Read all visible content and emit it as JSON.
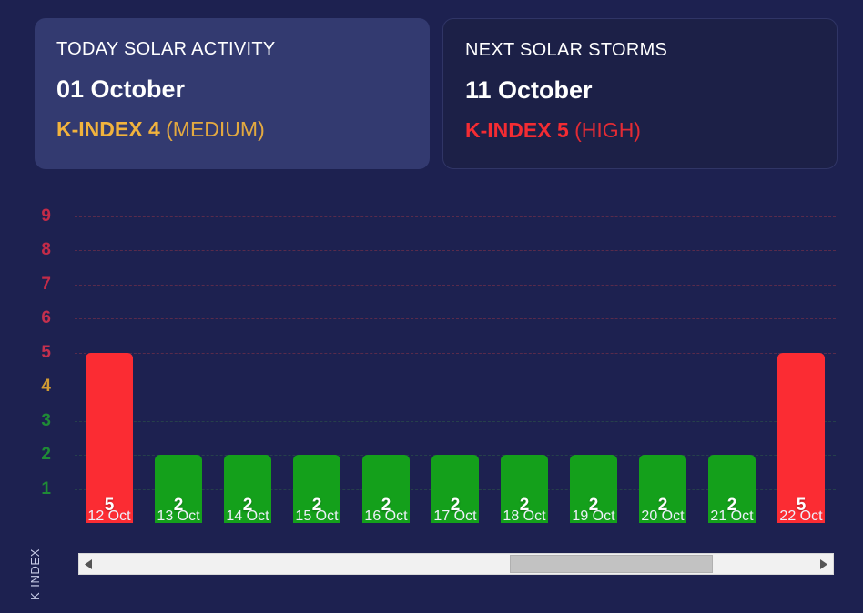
{
  "cards": [
    {
      "name": "today-solar-activity",
      "title": "TODAY SOLAR ACTIVITY",
      "date": "01 October",
      "kindex_text": "K-INDEX 4",
      "level_text": "(MEDIUM)",
      "accent": "#f2b33d"
    },
    {
      "name": "next-solar-storms",
      "title": "NEXT SOLAR STORMS",
      "date": "11 October",
      "kindex_text": "K-INDEX 5",
      "level_text": "(HIGH)",
      "accent": "#f42c33"
    }
  ],
  "chart_data": {
    "type": "bar",
    "title": "",
    "xlabel": "",
    "ylabel": "K-INDEX",
    "ylim": [
      0,
      9.6
    ],
    "grid": true,
    "legend_position": "none",
    "categories": [
      "12 Oct",
      "13 Oct",
      "14 Oct",
      "15 Oct",
      "16 Oct",
      "17 Oct",
      "18 Oct",
      "19 Oct",
      "20 Oct",
      "21 Oct",
      "22 Oct"
    ],
    "values": [
      5,
      2,
      2,
      2,
      2,
      2,
      2,
      2,
      2,
      2,
      5
    ],
    "bar_colors": [
      "#fb2c33",
      "#14a01b",
      "#14a01b",
      "#14a01b",
      "#14a01b",
      "#14a01b",
      "#14a01b",
      "#14a01b",
      "#14a01b",
      "#14a01b",
      "#fb2c33"
    ],
    "yticks": [
      {
        "value": 9,
        "label": "9",
        "color": "#c32b48"
      },
      {
        "value": 8,
        "label": "8",
        "color": "#c32b48"
      },
      {
        "value": 7,
        "label": "7",
        "color": "#c32b48"
      },
      {
        "value": 6,
        "label": "6",
        "color": "#c5304e"
      },
      {
        "value": 5,
        "label": "5",
        "color": "#c5304e"
      },
      {
        "value": 4,
        "label": "4",
        "color": "#d19b33"
      },
      {
        "value": 3,
        "label": "3",
        "color": "#1f8b36"
      },
      {
        "value": 2,
        "label": "2",
        "color": "#1f8b36"
      },
      {
        "value": 1,
        "label": "1",
        "color": "#1f8b36"
      }
    ],
    "gridline_colors": [
      "#8a3448",
      "#8a3448",
      "#8a3448",
      "#8a3448",
      "#8a3448",
      "#6b5a43",
      "#2f5a48",
      "#2f5a48",
      "#2f5a48"
    ]
  },
  "scrollbar": {
    "left_arrow": "◀",
    "right_arrow": "▶",
    "thumb_start_percent": 57.5,
    "thumb_width_percent": 28.3
  }
}
